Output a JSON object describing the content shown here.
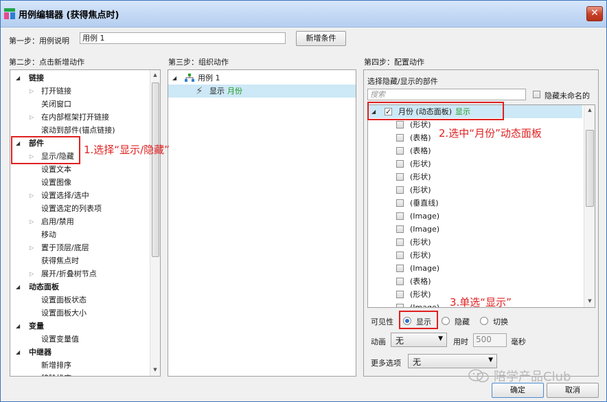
{
  "window": {
    "title": "用例编辑器 (获得焦点时)",
    "close_label": "✕"
  },
  "step1": {
    "label": "第一步：用例说明",
    "case_name": "用例 1",
    "add_condition": "新增条件"
  },
  "step2": {
    "label": "第二步：点击新增动作",
    "tree": [
      {
        "text": "链接",
        "level": 0,
        "group": true
      },
      {
        "text": "打开链接",
        "level": 1,
        "expander": true
      },
      {
        "text": "关闭窗口",
        "level": 1
      },
      {
        "text": "在内部框架打开链接",
        "level": 1,
        "expander": true
      },
      {
        "text": "滚动到部件(锚点链接)",
        "level": 1
      },
      {
        "text": "部件",
        "level": 0,
        "group": true
      },
      {
        "text": "显示/隐藏",
        "level": 1,
        "expander": true
      },
      {
        "text": "设置文本",
        "level": 1
      },
      {
        "text": "设置图像",
        "level": 1
      },
      {
        "text": "设置选择/选中",
        "level": 1,
        "expander": true
      },
      {
        "text": "设置选定的列表项",
        "level": 1
      },
      {
        "text": "启用/禁用",
        "level": 1,
        "expander": true
      },
      {
        "text": "移动",
        "level": 1
      },
      {
        "text": "置于顶层/底层",
        "level": 1,
        "expander": true
      },
      {
        "text": "获得焦点时",
        "level": 1
      },
      {
        "text": "展开/折叠树节点",
        "level": 1,
        "expander": true
      },
      {
        "text": "动态面板",
        "level": 0,
        "group": true
      },
      {
        "text": "设置面板状态",
        "level": 1
      },
      {
        "text": "设置面板大小",
        "level": 1
      },
      {
        "text": "变量",
        "level": 0,
        "group": true
      },
      {
        "text": "设置变量值",
        "level": 1
      },
      {
        "text": "中继器",
        "level": 0,
        "group": true
      },
      {
        "text": "新增排序",
        "level": 1
      },
      {
        "text": "移除排序",
        "level": 1
      }
    ]
  },
  "step3": {
    "label": "第三步：组织动作",
    "case_label": "用例 1",
    "action_verb": "显示",
    "action_target": "月份"
  },
  "step4": {
    "label": "第四步：配置动作",
    "section_label": "选择隐藏/显示的部件",
    "search_placeholder": "搜索",
    "hide_unnamed": "隐藏未命名的",
    "parent_name": "月份 (动态面板)",
    "parent_state": "显示",
    "children": [
      "(形状)",
      "(表格)",
      "(表格)",
      "(形状)",
      "(形状)",
      "(形状)",
      "(垂直线)",
      "(Image)",
      "(Image)",
      "(形状)",
      "(形状)",
      "(Image)",
      "(表格)",
      "(形状)",
      "(Image)"
    ],
    "visibility_label": "可见性",
    "visibility_options": [
      "显示",
      "隐藏",
      "切换"
    ],
    "visibility_selected": "显示",
    "animation_label": "动画",
    "animation_value": "无",
    "duration_label": "用时",
    "duration_value": "500",
    "duration_unit": "毫秒",
    "more_label": "更多选项",
    "more_value": "无"
  },
  "annotations": {
    "a1": "1.选择“显示/隐藏”",
    "a2": "2.选中“月份”动态面板",
    "a3": "3.单选“显示”"
  },
  "footer": {
    "ok": "确定",
    "cancel": "取消",
    "watermark": "陪学产品Club"
  },
  "colors": {
    "accent_green": "#1e9c1e",
    "annotation_red": "#e02020",
    "selection_blue": "#cde8f6"
  }
}
